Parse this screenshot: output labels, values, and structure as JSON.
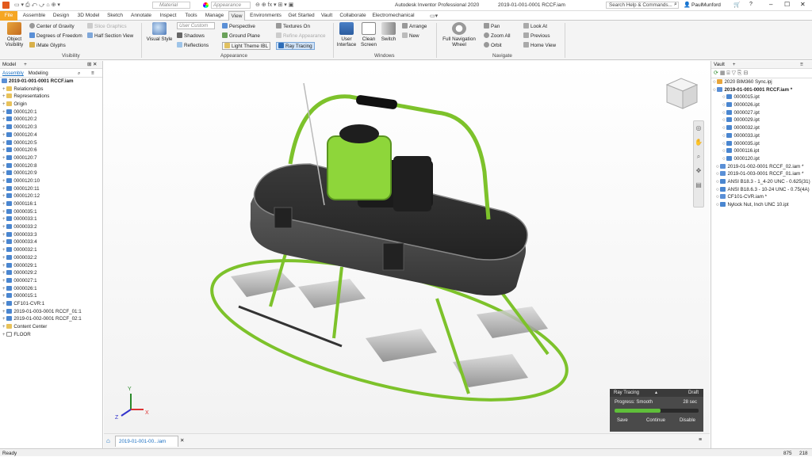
{
  "title": {
    "app": "Autodesk Inventor Professional 2020",
    "file": "2019-01-001-0001 RCCF.iam",
    "search_placeholder": "Search Help & Commands...",
    "user": "PaulMunford",
    "material": "Material",
    "appearance": "Appearance"
  },
  "tabs": [
    "File",
    "Assemble",
    "Design",
    "3D Model",
    "Sketch",
    "Annotate",
    "Inspect",
    "Tools",
    "Manage",
    "View",
    "Environments",
    "Get Started",
    "Vault",
    "Collaborate",
    "Electromechanical"
  ],
  "ribbon": {
    "object_visibility": "Object Visibility",
    "center_gravity": "Center of Gravity",
    "dof": "Degrees of Freedom",
    "imate": "iMate Glyphs",
    "slice_graphics": "Slice Graphics",
    "half_section": "Half Section View",
    "visibility_label": "Visibility",
    "visual_style": "Visual Style",
    "user_custom": "User Custom",
    "shadows": "Shadows",
    "reflections": "Reflections",
    "perspective": "Perspective",
    "ground_plane": "Ground Plane",
    "light_theme": "Light Theme IBL",
    "textures_on": "Textures On",
    "refine_appearance": "Refine Appearance",
    "ray_tracing": "Ray Tracing",
    "appearance_label": "Appearance",
    "user_interface": "User Interface",
    "clean_screen": "Clean Screen",
    "switch": "Switch",
    "arrange": "Arrange",
    "new": "New",
    "windows_label": "Windows",
    "full_nav_wheel": "Full Navigation Wheel",
    "pan": "Pan",
    "zoom_all": "Zoom All",
    "orbit": "Orbit",
    "look_at": "Look At",
    "previous": "Previous",
    "home_view": "Home View",
    "navigate_label": "Navigate"
  },
  "model_panel": {
    "title": "Model",
    "tab_assembly": "Assembly",
    "tab_modeling": "Modeling",
    "root": "2019-01-001-0001 RCCF.iam",
    "items": [
      "Relationships",
      "Representations",
      "Origin",
      "0000120:1",
      "0000120:2",
      "0000120:3",
      "0000120:4",
      "0000120:5",
      "0000120:6",
      "0000120:7",
      "0000120:8",
      "0000120:9",
      "0000120:10",
      "0000120:11",
      "0000120:12",
      "0000116:1",
      "0000035:1",
      "0000033:1",
      "0000033:2",
      "0000033:3",
      "0000033:4",
      "0000032:1",
      "0000032:2",
      "0000029:1",
      "0000029:2",
      "0000027:1",
      "0000026:1",
      "0000015:1",
      "CF101-CVR:1",
      "2019-01-003-0001 RCCF_01:1",
      "2019-01-002-0001 RCCF_02:1",
      "Content Center",
      "FLOOR"
    ]
  },
  "vault_panel": {
    "title": "Vault",
    "items": [
      "2020 BIM360 Sync.ipj",
      "2019-01-001-0001 RCCF.iam *",
      "0000015.ipt",
      "0000026.ipt",
      "0000027.ipt",
      "0000029.ipt",
      "0000032.ipt",
      "0000033.ipt",
      "0000035.ipt",
      "0000116.ipt",
      "0000120.ipt",
      "2019-01-002-0001 RCCF_02.iam *",
      "2019-01-003-0001 RCCF_01.iam *",
      "ANSI B18.3 - 1_4-20 UNC - 0.625(31)",
      "ANSI B18.6.3 - 10-24 UNC - 0.75(4A)",
      "CF101-CVR.iam *",
      "Nylock Nut, Inch UNC 10.ipt"
    ]
  },
  "raytrace": {
    "title": "Ray Tracing",
    "mode": "Draft",
    "progress_label": "Progress: Smooth",
    "time": "28 sec",
    "progress": 0.55,
    "save": "Save",
    "continue": "Continue",
    "disable": "Disable"
  },
  "doc_tab": "2019-01-001-00...iam",
  "status": {
    "ready": "Ready",
    "n1": "875",
    "n2": "218"
  },
  "colors": {
    "accent": "#1a6fc2",
    "file_tab": "#f5a623",
    "green": "#7dc22b"
  }
}
